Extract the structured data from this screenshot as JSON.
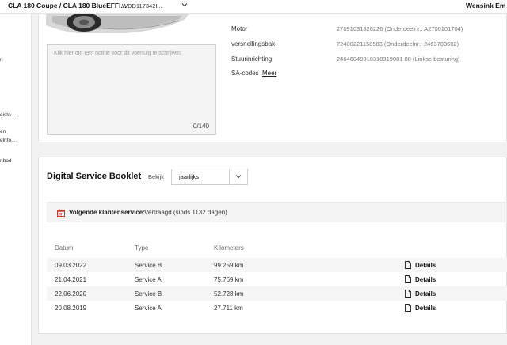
{
  "topbar": {
    "vehicle_title": "CLA 180 Coupe / CLA 180 BlueEFFI...",
    "vin": "WDD117342I...",
    "user": "Wensink Em"
  },
  "nav_fragments": [
    "n",
    "eisto...",
    "en",
    "elnfo...",
    "nbod"
  ],
  "note": {
    "placeholder": "Klik hier om een notitie voor dit voertuig te schrijven.",
    "counter": "0/140"
  },
  "specs": [
    {
      "label": "Motor",
      "value": "27091031826226 (Onderdeelnr.: A2700101704)"
    },
    {
      "label": "versnellingsbak",
      "value": "72400221158583 (Onderdeelnr.: 2463703602)"
    },
    {
      "label": "Stuurinrichting",
      "value": "24646049010318319081 88 (Linkse besturing)"
    },
    {
      "label": "SA-codes",
      "value": ""
    }
  ],
  "sa_link": "Meer",
  "booklet": {
    "title": "Digital Service Booklet",
    "view_label": "Bekijk",
    "view_value": "jaarlijks",
    "next_service_label": "Volgende klantenservice:",
    "next_service_value": "Vertraagd (sinds 1132 dagen)",
    "headers": {
      "date": "Datum",
      "type": "Type",
      "km": "Kilometers"
    },
    "rows": [
      {
        "date": "09.03.2022",
        "type": "Service B",
        "km": "99.259 km",
        "details": "Details"
      },
      {
        "date": "21.04.2021",
        "type": "Service A",
        "km": "75.769 km",
        "details": "Details"
      },
      {
        "date": "22.06.2020",
        "type": "Service B",
        "km": "52.728 km",
        "details": "Details"
      },
      {
        "date": "20.08.2019",
        "type": "Service A",
        "km": "27.711 km",
        "details": "Details"
      }
    ]
  },
  "colors": {
    "alert_red": "#c0392b",
    "background": "#f2f2f2"
  }
}
